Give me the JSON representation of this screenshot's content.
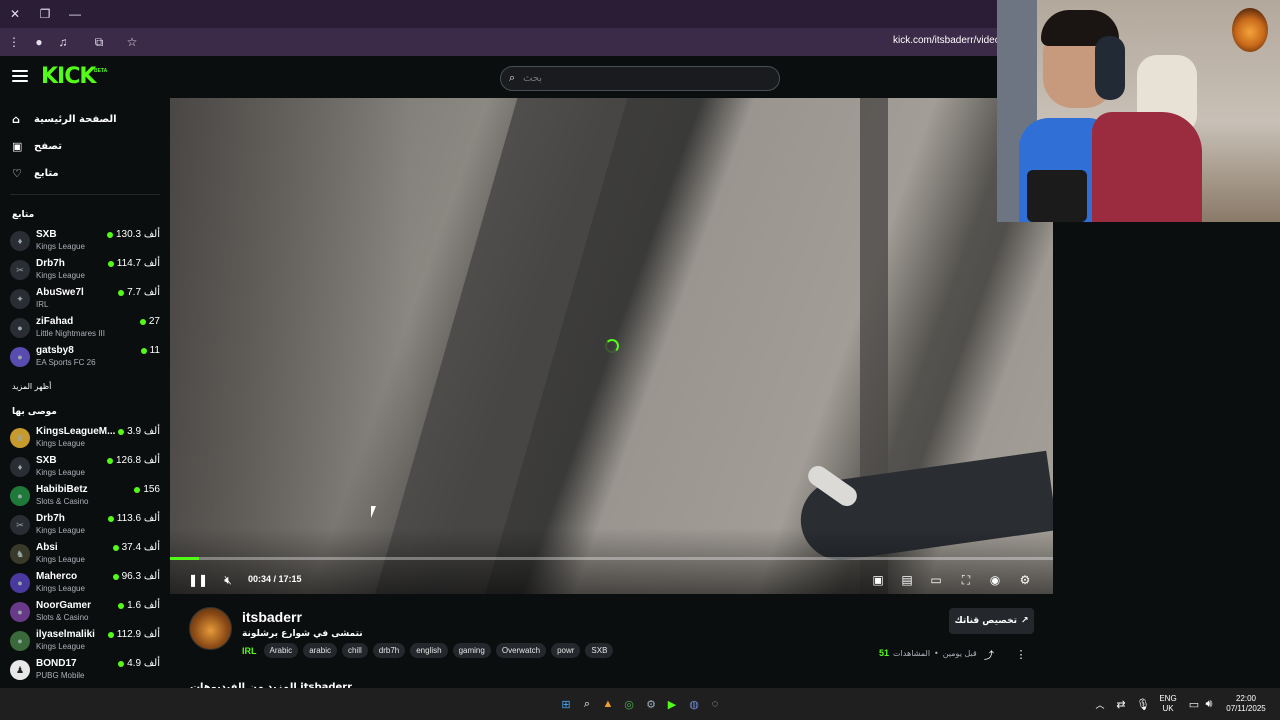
{
  "browser": {
    "url": "kick.com/itsbaderr/videos",
    "window_controls": [
      "close-icon",
      "restore-icon",
      "minimize-icon"
    ],
    "toolbar_icons": [
      "more-vert-icon",
      "profile-icon",
      "media-icon",
      "extensions-icon",
      "star-icon"
    ]
  },
  "header": {
    "logo": "KICK",
    "beta": "BETA",
    "search_placeholder": "بحث"
  },
  "nav": [
    {
      "label": "الصفحة الرئيسية",
      "icon": "home-icon"
    },
    {
      "label": "تصفح",
      "icon": "browse-icon"
    },
    {
      "label": "متابع",
      "icon": "heart-icon"
    }
  ],
  "following": {
    "title": "متابع",
    "show_more": "أظهر المزيد",
    "channels": [
      {
        "name": "SXB",
        "category": "Kings League",
        "viewers": "130.3 ألف"
      },
      {
        "name": "Drb7h",
        "category": "Kings League",
        "viewers": "114.7 ألف"
      },
      {
        "name": "AbuSwe7l",
        "category": "IRL",
        "viewers": "7.7 ألف"
      },
      {
        "name": "ziFahad",
        "category": "Little Nightmares III",
        "viewers": "27"
      },
      {
        "name": "gatsby8",
        "category": "EA Sports FC 26",
        "viewers": "11"
      }
    ]
  },
  "recommended": {
    "title": "موصى بها",
    "channels": [
      {
        "name": "KingsLeagueM...",
        "category": "Kings League",
        "viewers": "3.9 ألف"
      },
      {
        "name": "SXB",
        "category": "Kings League",
        "viewers": "126.8 ألف"
      },
      {
        "name": "HabibiBetz",
        "category": "Slots & Casino",
        "viewers": "156"
      },
      {
        "name": "Drb7h",
        "category": "Kings League",
        "viewers": "113.6 ألف"
      },
      {
        "name": "Absi",
        "category": "Kings League",
        "viewers": "37.4 ألف"
      },
      {
        "name": "Maherco",
        "category": "Kings League",
        "viewers": "96.3 ألف"
      },
      {
        "name": "NoorGamer",
        "category": "Slots & Casino",
        "viewers": "1.6 ألف"
      },
      {
        "name": "ilyaselmaliki",
        "category": "Kings League",
        "viewers": "112.9 ألف"
      },
      {
        "name": "BOND17",
        "category": "PUBG Mobile",
        "viewers": "4.9 ألف"
      }
    ]
  },
  "player": {
    "time": "00:34 / 17:15",
    "progress": 0.033,
    "controls_left": [
      "pause-icon",
      "mute-icon"
    ],
    "controls_right": [
      "miniplayer-icon",
      "theater-icon",
      "captions-icon",
      "fullscreen-icon",
      "autoplay-icon",
      "settings-icon"
    ]
  },
  "channel": {
    "name": "itsbaderr",
    "title": "نتمشى في شوارع برشلونة",
    "category": "IRL",
    "tags": [
      "Arabic",
      "arabic",
      "chill",
      "drb7h",
      "english",
      "gaming",
      "Overwatch",
      "powr",
      "SXB"
    ],
    "clip_button": "تخصيص قناتك",
    "views_count": "51",
    "views_label": "المشاهدات",
    "separator": "•",
    "posted": "قبل يومين",
    "cutoff_text": "المزيد من الفيديوهات itsbaderr"
  },
  "taskbar": {
    "icons": [
      "windows-icon",
      "search-icon",
      "files-icon",
      "chrome-icon",
      "settings-icon",
      "play-icon",
      "discord-icon",
      "obs-icon"
    ],
    "lang_top": "ENG",
    "lang_bottom": "UK",
    "time": "22:00",
    "date": "07/11/2025"
  }
}
